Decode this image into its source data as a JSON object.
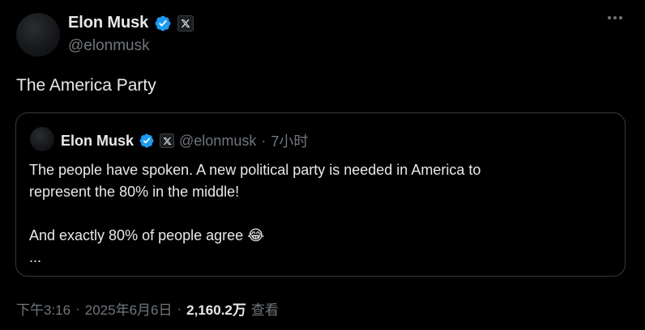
{
  "post": {
    "author": {
      "name": "Elon Musk",
      "handle": "@elonmusk",
      "verified_color": "#1d9bf0"
    },
    "text": "The America Party",
    "quoted": {
      "author": {
        "name": "Elon Musk",
        "handle": "@elonmusk"
      },
      "separator": "·",
      "time": "7小时",
      "lines": [
        "The people have spoken. A new political party is needed in America to",
        "represent the 80% in the middle!",
        "And exactly 80% of people agree 😂",
        "..."
      ]
    },
    "meta": {
      "time": "下午3:16",
      "date": "2025年6月6日",
      "separator": "·",
      "views_count": "2,160.2万",
      "views_label": "查看"
    }
  },
  "icons": {
    "verified": "verified-badge-icon",
    "affiliate": "x-logo-icon",
    "more": "more-options-icon"
  },
  "colors": {
    "background": "#000000",
    "text_primary": "#e7e9ea",
    "text_secondary": "#71767b",
    "border": "#363b3f",
    "accent": "#1d9bf0"
  }
}
